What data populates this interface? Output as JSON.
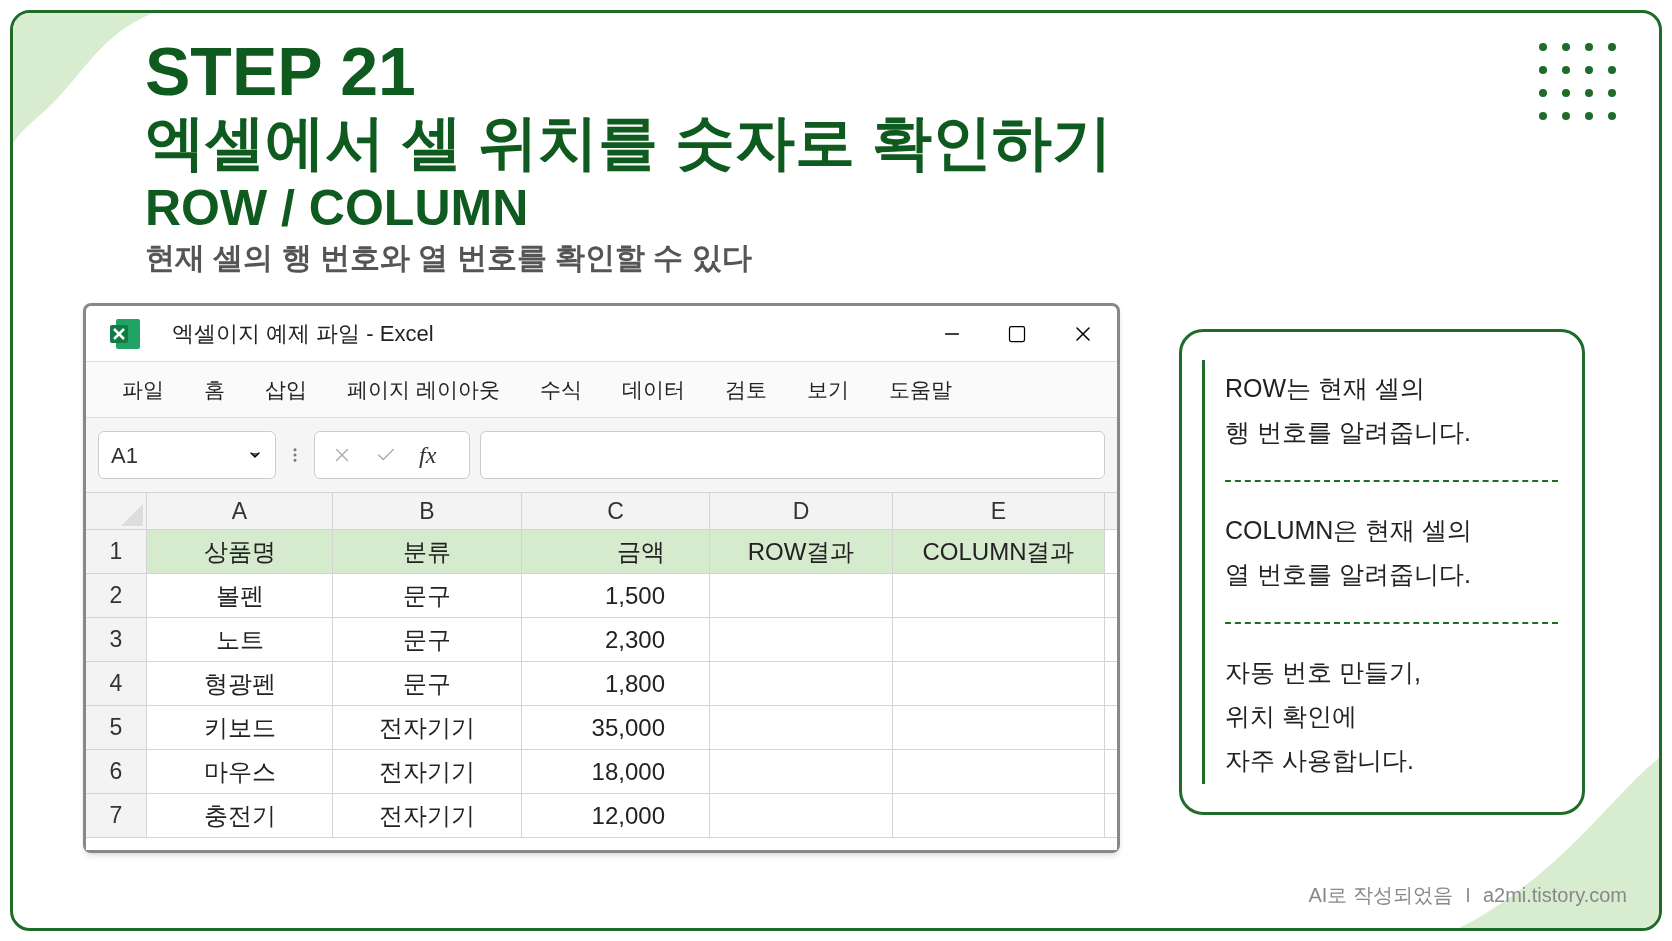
{
  "title": {
    "step": "STEP 21",
    "heading": "엑셀에서 셀 위치를 숫자로 확인하기",
    "subheading": "ROW / COLUMN",
    "description": "현재 셀의 행 번호와 열 번호를 확인할 수 있다"
  },
  "window": {
    "title": "엑셀이지 예제 파일 - Excel"
  },
  "menu": [
    "파일",
    "홈",
    "삽입",
    "페이지 레이아웃",
    "수식",
    "데이터",
    "검토",
    "보기",
    "도움말"
  ],
  "name_box": {
    "value": "A1"
  },
  "formula_bar": {
    "fx_label": "fx"
  },
  "sheet": {
    "columns": [
      "A",
      "B",
      "C",
      "D",
      "E"
    ],
    "rows": [
      {
        "number": "1",
        "highlighted": true,
        "cells": [
          "상품명",
          "분류",
          "금액",
          "ROW결과",
          "COLUMN결과"
        ]
      },
      {
        "number": "2",
        "highlighted": false,
        "cells": [
          "볼펜",
          "문구",
          "1,500",
          "",
          ""
        ]
      },
      {
        "number": "3",
        "highlighted": false,
        "cells": [
          "노트",
          "문구",
          "2,300",
          "",
          ""
        ]
      },
      {
        "number": "4",
        "highlighted": false,
        "cells": [
          "형광펜",
          "문구",
          "1,800",
          "",
          ""
        ]
      },
      {
        "number": "5",
        "highlighted": false,
        "cells": [
          "키보드",
          "전자기기",
          "35,000",
          "",
          ""
        ]
      },
      {
        "number": "6",
        "highlighted": false,
        "cells": [
          "마우스",
          "전자기기",
          "18,000",
          "",
          ""
        ]
      },
      {
        "number": "7",
        "highlighted": false,
        "cells": [
          "충전기",
          "전자기기",
          "12,000",
          "",
          ""
        ]
      }
    ]
  },
  "notes": [
    {
      "lines": [
        "ROW는 현재 셀의",
        "행 번호를 알려줍니다."
      ]
    },
    {
      "lines": [
        "COLUMN은 현재 셀의",
        "열 번호를 알려줍니다."
      ]
    },
    {
      "lines": [
        "자동 번호 만들기,",
        "위치 확인에",
        "자주 사용합니다."
      ]
    }
  ],
  "footer": {
    "credit": "AI로 작성되었음",
    "site": "a2mi.tistory.com"
  }
}
